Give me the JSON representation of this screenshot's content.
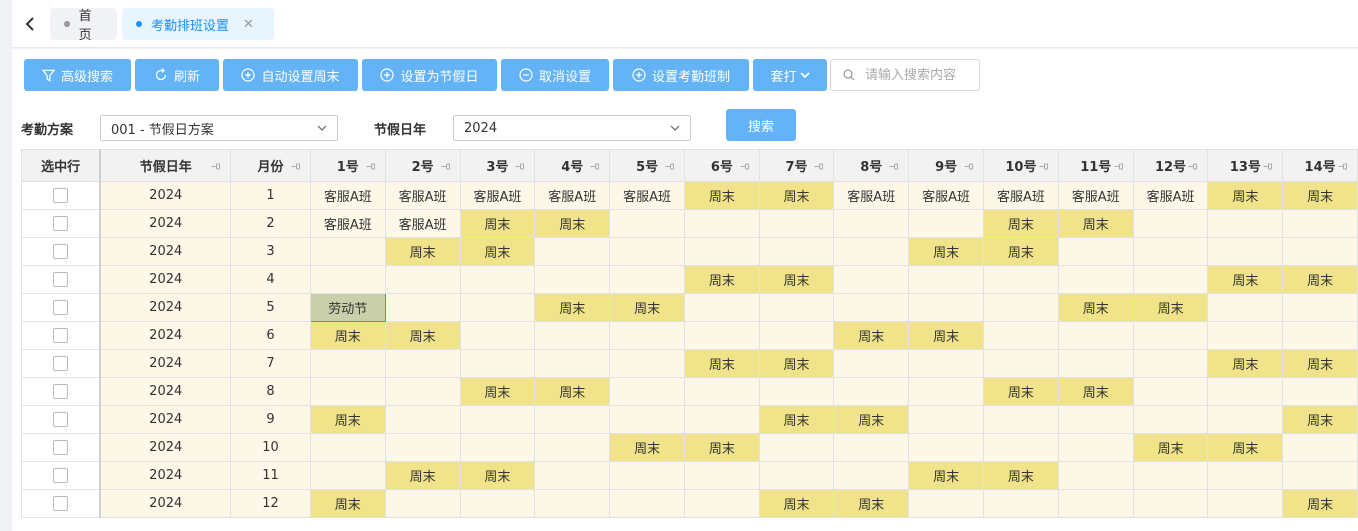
{
  "tabs": {
    "home_label": "首页",
    "active_label": "考勤排班设置"
  },
  "toolbar": {
    "advanced_search": "高级搜索",
    "refresh": "刷新",
    "auto_weekend": "自动设置周末",
    "set_holiday": "设置为节假日",
    "cancel_setting": "取消设置",
    "set_shift": "设置考勤班制",
    "apply": "套打",
    "search_placeholder": "请输入搜索内容"
  },
  "filters": {
    "plan_label": "考勤方案",
    "plan_value": "001 - 节假日方案",
    "year_label": "节假日年",
    "year_value": "2024",
    "search_button": "搜索"
  },
  "table": {
    "headers": [
      "选中行",
      "节假日年",
      "月份",
      "1号",
      "2号",
      "3号",
      "4号",
      "5号",
      "6号",
      "7号",
      "8号",
      "9号",
      "10号",
      "11号",
      "12号",
      "13号",
      "14号"
    ],
    "rows": [
      {
        "year": "2024",
        "month": "1",
        "days": [
          "客服A班",
          "客服A班",
          "客服A班",
          "客服A班",
          "客服A班",
          "周末",
          "周末",
          "客服A班",
          "客服A班",
          "客服A班",
          "客服A班",
          "客服A班",
          "周末",
          "周末"
        ]
      },
      {
        "year": "2024",
        "month": "2",
        "days": [
          "客服A班",
          "客服A班",
          "周末",
          "周末",
          "",
          "",
          "",
          "",
          "",
          "周末",
          "周末",
          "",
          "",
          ""
        ]
      },
      {
        "year": "2024",
        "month": "3",
        "days": [
          "",
          "周末",
          "周末",
          "",
          "",
          "",
          "",
          "",
          "周末",
          "周末",
          "",
          "",
          "",
          ""
        ]
      },
      {
        "year": "2024",
        "month": "4",
        "days": [
          "",
          "",
          "",
          "",
          "",
          "周末",
          "周末",
          "",
          "",
          "",
          "",
          "",
          "周末",
          "周末"
        ]
      },
      {
        "year": "2024",
        "month": "5",
        "days": [
          "劳动节",
          "",
          "",
          "周末",
          "周末",
          "",
          "",
          "",
          "",
          "",
          "周末",
          "周末",
          "",
          ""
        ]
      },
      {
        "year": "2024",
        "month": "6",
        "days": [
          "周末",
          "周末",
          "",
          "",
          "",
          "",
          "",
          "周末",
          "周末",
          "",
          "",
          "",
          "",
          ""
        ]
      },
      {
        "year": "2024",
        "month": "7",
        "days": [
          "",
          "",
          "",
          "",
          "",
          "周末",
          "周末",
          "",
          "",
          "",
          "",
          "",
          "周末",
          "周末"
        ]
      },
      {
        "year": "2024",
        "month": "8",
        "days": [
          "",
          "",
          "周末",
          "周末",
          "",
          "",
          "",
          "",
          "",
          "周末",
          "周末",
          "",
          "",
          ""
        ]
      },
      {
        "year": "2024",
        "month": "9",
        "days": [
          "周末",
          "",
          "",
          "",
          "",
          "",
          "周末",
          "周末",
          "",
          "",
          "",
          "",
          "",
          "周末"
        ]
      },
      {
        "year": "2024",
        "month": "10",
        "days": [
          "",
          "",
          "",
          "",
          "周末",
          "周末",
          "",
          "",
          "",
          "",
          "",
          "周末",
          "周末",
          ""
        ]
      },
      {
        "year": "2024",
        "month": "11",
        "days": [
          "",
          "周末",
          "周末",
          "",
          "",
          "",
          "",
          "",
          "周末",
          "周末",
          "",
          "",
          "",
          ""
        ]
      },
      {
        "year": "2024",
        "month": "12",
        "days": [
          "周末",
          "",
          "",
          "",
          "",
          "",
          "周末",
          "周末",
          "",
          "",
          "",
          "",
          "",
          "周末"
        ]
      }
    ],
    "highlight_color": "#f0e38a",
    "holiday_color": "#c9cfa8",
    "row_bg_color": "#fdf7e8"
  },
  "colors": {
    "primary": "#63b3f6",
    "active_tab": "#1890ff"
  }
}
